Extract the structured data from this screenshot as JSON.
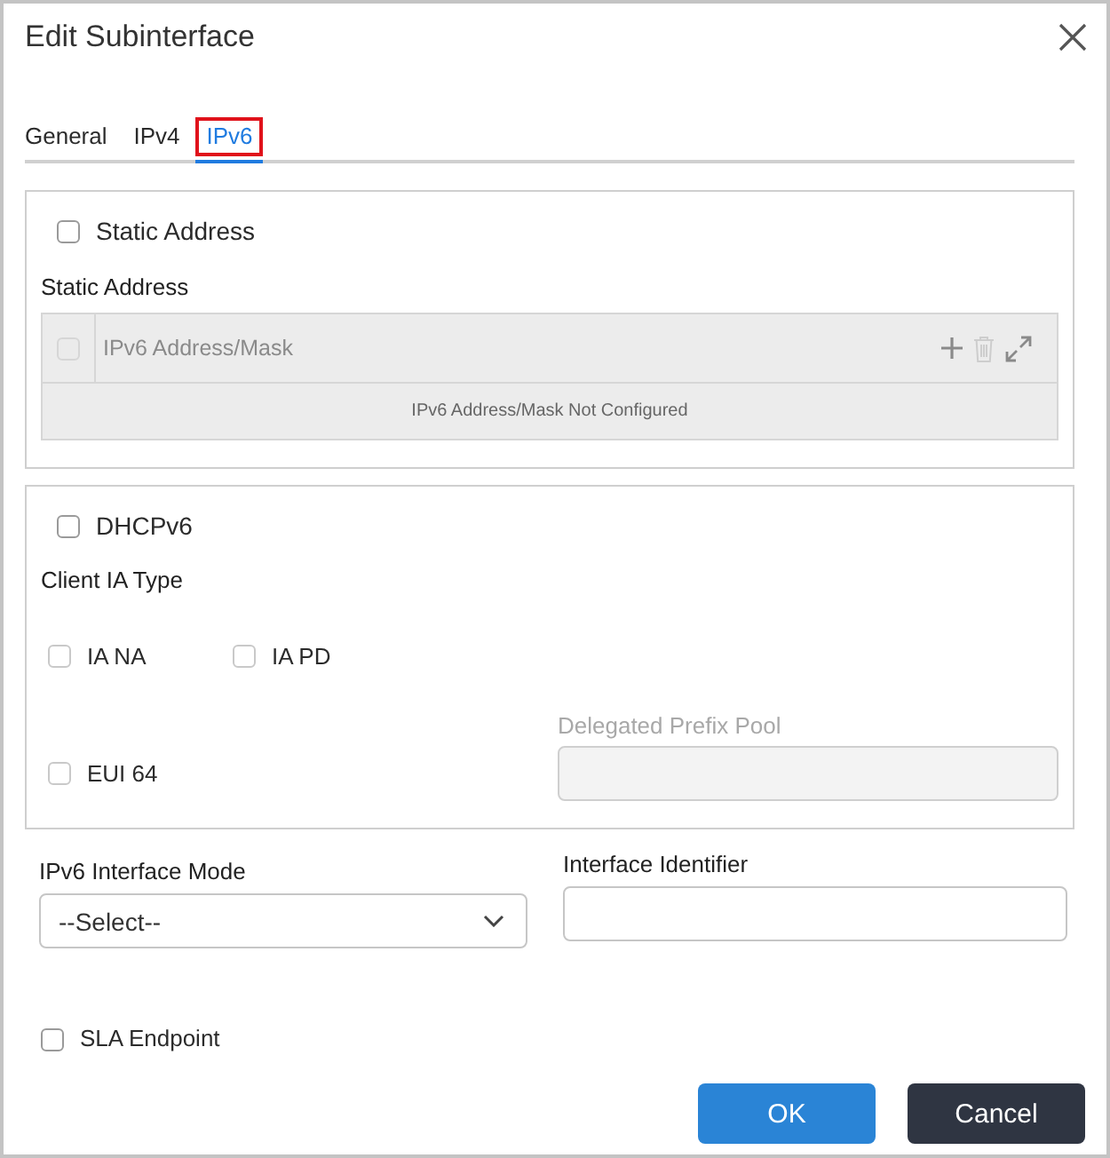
{
  "dialog": {
    "title": "Edit Subinterface"
  },
  "tabs": [
    {
      "label": "General",
      "selected": false,
      "highlighted": false
    },
    {
      "label": "IPv4",
      "selected": false,
      "highlighted": false
    },
    {
      "label": "IPv6",
      "selected": true,
      "highlighted": true
    }
  ],
  "static_address": {
    "label": "Static Address",
    "checked": false,
    "table_title": "Static Address",
    "table": {
      "select_all": {
        "checked": false,
        "disabled": true
      },
      "columns": [
        "IPv6 Address/Mask"
      ],
      "actions": [
        {
          "kind": "add",
          "disabled": false
        },
        {
          "kind": "delete",
          "disabled": true
        },
        {
          "kind": "expand",
          "disabled": false
        }
      ],
      "empty_message": "IPv6 Address/Mask Not Configured"
    }
  },
  "dhcpv6": {
    "label": "DHCPv6",
    "checked": false,
    "client_ia_type": "Client IA Type",
    "options": [
      {
        "label": "IA NA",
        "checked": false
      },
      {
        "label": "IA PD",
        "checked": false
      },
      {
        "label": "EUI 64",
        "checked": false
      }
    ],
    "delegated_prefix_pool": {
      "label": "Delegated Prefix Pool",
      "disabled": true
    }
  },
  "interface_mode": {
    "label": "IPv6 Interface Mode",
    "value": "--Select--"
  },
  "interface_identifier": {
    "label": "Interface Identifier"
  },
  "sla_endpoint": {
    "label": "SLA Endpoint",
    "checked": false
  },
  "buttons": [
    {
      "label": "OK",
      "kind": "primary"
    },
    {
      "label": "Cancel",
      "kind": "secondary"
    }
  ]
}
